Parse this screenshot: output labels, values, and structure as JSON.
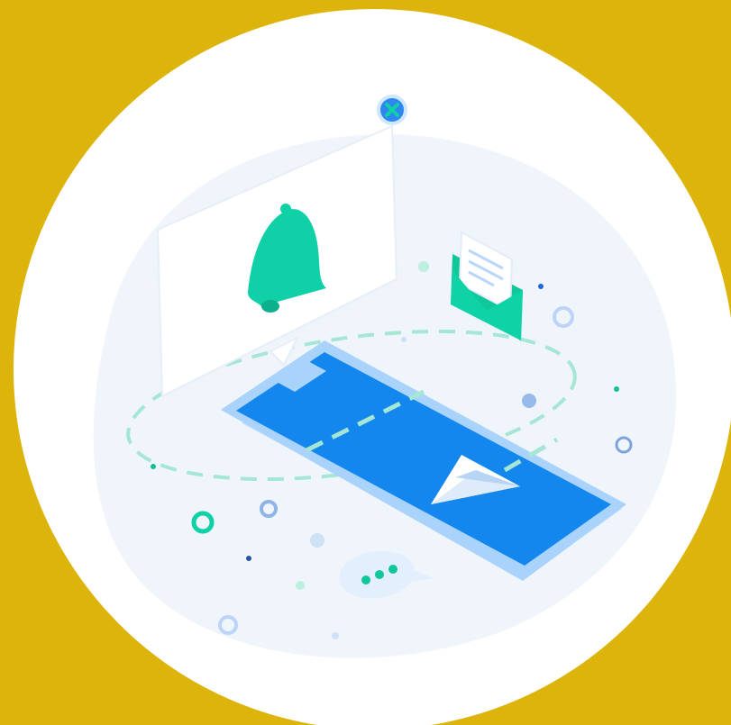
{
  "illustration": {
    "subject": "isometric-notification-illustration",
    "icons": {
      "bell": "bell-icon",
      "envelope": "envelope-icon",
      "phone": "smartphone-icon",
      "paper_plane": "paper-plane-icon",
      "chat": "chat-bubble-icon",
      "close": "close-icon"
    },
    "colors": {
      "background_gold": "#DDB40C",
      "disc_white": "#FFFFFF",
      "backdrop_tint": "#F0F5FB",
      "phone_blue": "#1487EE",
      "phone_bezel": "#A9D3FB",
      "accent_teal": "#10D0A7",
      "panel_white": "#FFFFFF",
      "dot_blue": "#96B9EA",
      "dashed_mint": "#A5E6D5"
    }
  }
}
